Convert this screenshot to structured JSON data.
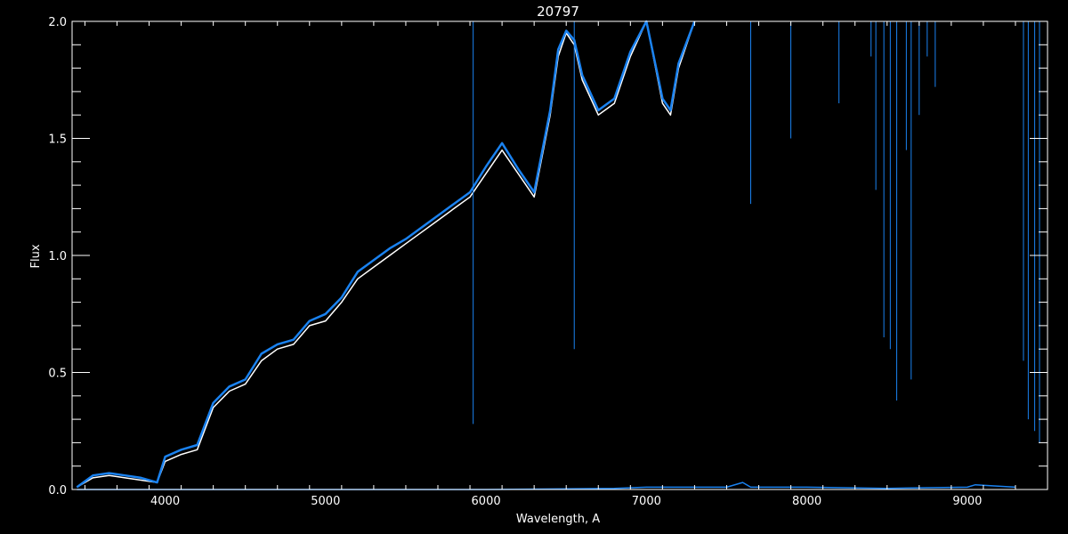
{
  "chart_data": {
    "type": "line",
    "title": "20797",
    "xlabel": "Wavelength, A",
    "ylabel": "Flux",
    "xlim": [
      3420,
      9500
    ],
    "ylim": [
      0,
      2.0
    ],
    "x_ticks": [
      4000,
      5000,
      6000,
      7000,
      8000,
      9000
    ],
    "x_tick_labels": [
      "4000",
      "5000",
      "6000",
      "7000",
      "8000",
      "9000"
    ],
    "y_ticks": [
      0.0,
      0.5,
      1.0,
      1.5,
      2.0
    ],
    "y_tick_labels": [
      "0.0",
      "0.5",
      "1.0",
      "1.5",
      "2.0"
    ],
    "background_color": "#000000",
    "axes_color": "#ffffff",
    "grid": false,
    "series": [
      {
        "color": "#ffffff",
        "x": [
          3450,
          3550,
          3650,
          3750,
          3850,
          3950,
          4000,
          4100,
          4200,
          4300,
          4400,
          4500,
          4600,
          4700,
          4800,
          4900,
          5000,
          5100,
          5200,
          5300,
          5400,
          5500,
          5600,
          5700,
          5800,
          5900,
          6000,
          6100,
          6200,
          6300,
          6400,
          6450,
          6500,
          6550,
          6600,
          6700,
          6800,
          6900,
          7000,
          7100,
          7150,
          7200,
          7300
        ],
        "y": [
          0.01,
          0.05,
          0.06,
          0.05,
          0.04,
          0.03,
          0.12,
          0.15,
          0.17,
          0.35,
          0.42,
          0.45,
          0.55,
          0.6,
          0.62,
          0.7,
          0.72,
          0.8,
          0.9,
          0.95,
          1.0,
          1.05,
          1.1,
          1.15,
          1.2,
          1.25,
          1.35,
          1.45,
          1.35,
          1.25,
          1.6,
          1.85,
          1.95,
          1.9,
          1.75,
          1.6,
          1.65,
          1.85,
          2.0,
          1.65,
          1.6,
          1.8,
          2.0
        ]
      },
      {
        "color": "#1a82f0",
        "x": [
          3450,
          3550,
          3650,
          3750,
          3850,
          3950,
          4000,
          4100,
          4200,
          4300,
          4400,
          4500,
          4600,
          4700,
          4800,
          4900,
          5000,
          5100,
          5200,
          5300,
          5400,
          5500,
          5600,
          5700,
          5800,
          5900,
          6000,
          6100,
          6200,
          6300,
          6400,
          6450,
          6500,
          6550,
          6600,
          6700,
          6800,
          6900,
          7000,
          7100,
          7150,
          7200,
          7300
        ],
        "y": [
          0.01,
          0.06,
          0.07,
          0.06,
          0.05,
          0.03,
          0.14,
          0.17,
          0.19,
          0.37,
          0.44,
          0.47,
          0.58,
          0.62,
          0.64,
          0.72,
          0.75,
          0.82,
          0.93,
          0.98,
          1.03,
          1.07,
          1.12,
          1.17,
          1.22,
          1.27,
          1.38,
          1.48,
          1.37,
          1.27,
          1.62,
          1.88,
          1.96,
          1.92,
          1.77,
          1.62,
          1.67,
          1.87,
          2.0,
          1.67,
          1.62,
          1.82,
          2.0
        ]
      },
      {
        "color": "#1a82f0",
        "x": [
          3450,
          5000,
          6000,
          6800,
          7000,
          7500,
          7600,
          7650,
          8000,
          8500,
          9000,
          9050,
          9300
        ],
        "y": [
          0.0,
          0.0,
          0.0,
          0.005,
          0.01,
          0.01,
          0.03,
          0.01,
          0.01,
          0.005,
          0.01,
          0.02,
          0.01
        ]
      }
    ],
    "spikes": {
      "color": "#1a82f0",
      "x": [
        5920,
        6550,
        7650,
        7900,
        8200,
        8400,
        8430,
        8480,
        8520,
        8560,
        8620,
        8650,
        8700,
        8750,
        8800,
        9350,
        9380,
        9420,
        9450
      ],
      "y": [
        0.28,
        0.6,
        1.22,
        1.5,
        1.65,
        1.85,
        1.28,
        0.65,
        0.6,
        0.38,
        1.45,
        0.47,
        1.6,
        1.85,
        1.72,
        0.55,
        0.3,
        0.25,
        0.2
      ]
    }
  }
}
